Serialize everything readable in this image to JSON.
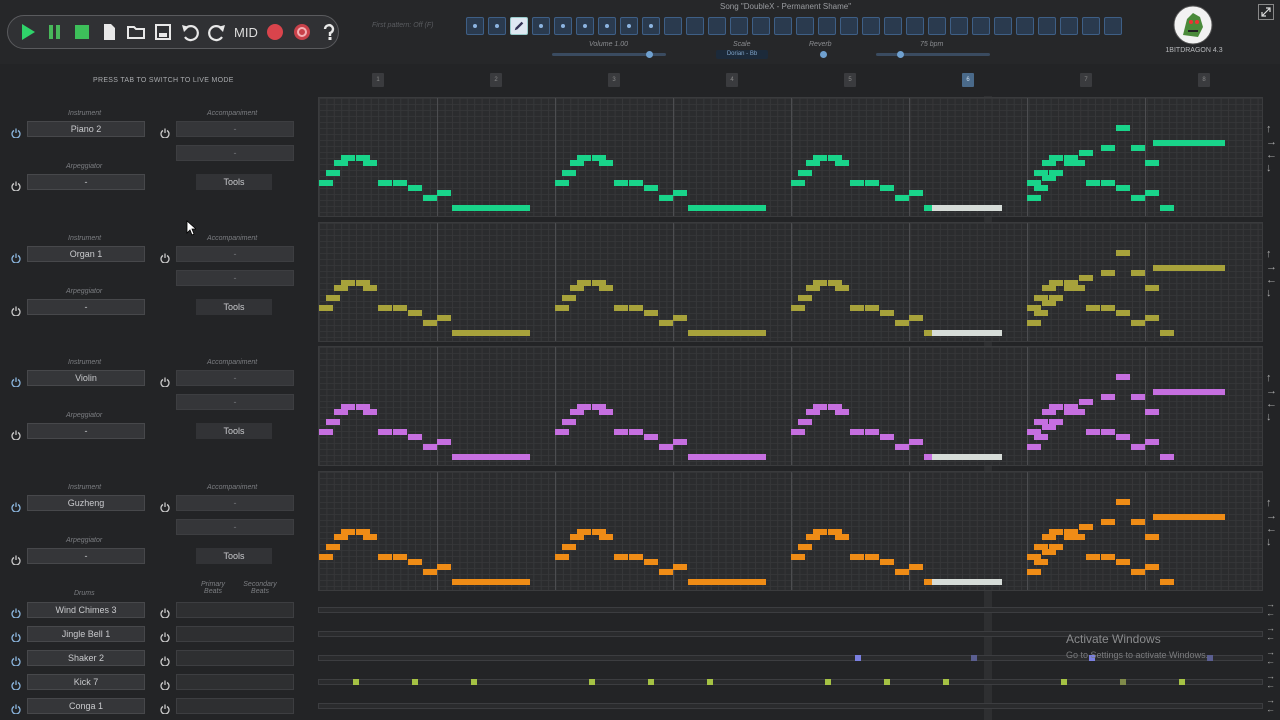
{
  "window": {
    "song_title": "Song \"DoubleX - Permanent Shame\"",
    "app_name": "1BITDRAGON 4.3"
  },
  "toolbar": {
    "mid_label": "MID",
    "play": "play-icon",
    "pause": "pause-icon",
    "stop": "stop-icon",
    "new": "file-icon",
    "open": "folder-icon",
    "save": "save-icon",
    "undo": "undo-icon",
    "redo": "redo-icon",
    "record": "record-icon",
    "loop": "loop-icon",
    "help": "help-icon"
  },
  "first_pattern_text": "First pattern: Off (F)",
  "controls": {
    "volume": "Volume 1.00",
    "scale_label": "Scale",
    "scale_value": "Dorian - Bb",
    "reverb": "Reverb",
    "bpm": "75 bpm",
    "volume_level": 0.88,
    "reverb_level": 0.0,
    "bpm_level": 0.2
  },
  "live_mode_hint": "PRESS TAB TO SWITCH TO LIVE MODE",
  "bars": [
    "1",
    "2",
    "3",
    "4",
    "5",
    "6",
    "7",
    "8"
  ],
  "current_bar": 6,
  "labels": {
    "instrument": "Instrument",
    "accompaniment": "Accompaniment",
    "arpeggiator": "Arpeggiator",
    "tools": "Tools",
    "dash": "-",
    "drums": "Drums",
    "primary_beats": "Primary Beats",
    "secondary_beats": "Secondary Beats"
  },
  "tracks": [
    {
      "instrument": "Piano 2",
      "color": "#19d48a"
    },
    {
      "instrument": "Organ 1",
      "color": "#a7a23b"
    },
    {
      "instrument": "Violin",
      "color": "#c66fe0"
    },
    {
      "instrument": "Guzheng",
      "color": "#ef8c16"
    }
  ],
  "drums": [
    {
      "name": "Wind Chimes 3"
    },
    {
      "name": "Jingle Bell 1"
    },
    {
      "name": "Shaker 2"
    },
    {
      "name": "Kick 7"
    },
    {
      "name": "Conga 1"
    }
  ],
  "activate": {
    "title": "Activate Windows",
    "subtitle": "Go to Settings to activate Windows."
  }
}
